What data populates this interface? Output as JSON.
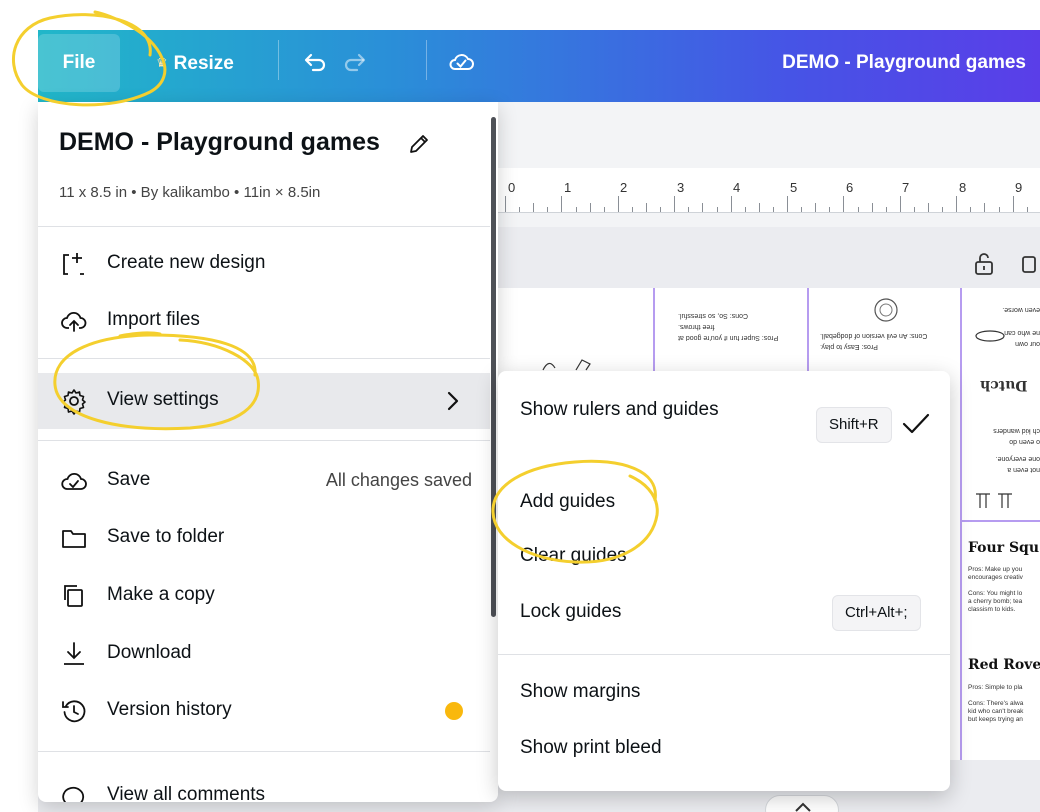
{
  "topbar": {
    "file_label": "File",
    "resize_label": "Resize",
    "doc_title": "DEMO - Playground games",
    "icons": [
      "undo-icon",
      "redo-icon",
      "cloud-saved-icon"
    ]
  },
  "ruler": {
    "numbers": [
      "0",
      "1",
      "2",
      "3",
      "4",
      "5",
      "6",
      "7",
      "8",
      "9"
    ]
  },
  "file_menu": {
    "title": "DEMO - Playground games",
    "meta": "11 x 8.5 in • By kalikambo • 11in × 8.5in",
    "items": [
      {
        "label": "Create new design",
        "icon": "create-design-icon"
      },
      {
        "label": "Import files",
        "icon": "upload-cloud-icon"
      },
      {
        "label": "View settings",
        "icon": "gear-icon"
      },
      {
        "label": "Save",
        "icon": "cloud-check-icon",
        "right": "All changes saved"
      },
      {
        "label": "Save to folder",
        "icon": "folder-icon"
      },
      {
        "label": "Make a copy",
        "icon": "copy-icon"
      },
      {
        "label": "Download",
        "icon": "download-icon"
      },
      {
        "label": "Version history",
        "icon": "history-icon"
      },
      {
        "label": "View all comments",
        "icon": "comment-icon"
      }
    ]
  },
  "submenu": {
    "items": [
      {
        "label": "Show rulers and guides",
        "shortcut": "Shift+R",
        "checked": true
      },
      {
        "label": "Add guides"
      },
      {
        "label": "Clear guides"
      },
      {
        "label": "Lock guides",
        "shortcut": "Ctrl+Alt+;"
      },
      {
        "label": "Show margins"
      },
      {
        "label": "Show print bleed"
      }
    ]
  },
  "canvas": {
    "card_left_lines": [
      "Cons: So, so stressful.",
      "free throws.",
      "Pros: Super fun if you're good at"
    ],
    "card_mid_lines": [
      "Cons: An evil version of dodgeball.",
      "Pros: Easy to play."
    ],
    "card_right_lines": [
      "even worse.",
      "ne who can",
      "our own",
      "ch kid wanders",
      "o even do",
      "one everyone.",
      "not even a"
    ],
    "four_square_title": "Four Squ",
    "four_square_lines": [
      "Pros: Make up you",
      "encourages creativ",
      "",
      "Cons: You might lo",
      "a cherry bomb; tea",
      "classism to kids."
    ],
    "red_rover_title": "Red Rove",
    "red_rover_lines": [
      "Pros: Simple to pla",
      "",
      "Cons: There's alwa",
      "kid who can't break",
      "but keeps trying an"
    ],
    "dutch_label": "Dutch"
  },
  "colors": {
    "topbar_gradient_start": "#21b7c9",
    "topbar_gradient_end": "#5a3ee8",
    "highlight_circle": "#f4cf2e",
    "guide_purple": "#b69cf0",
    "premium_badge": "#f9b80d"
  }
}
